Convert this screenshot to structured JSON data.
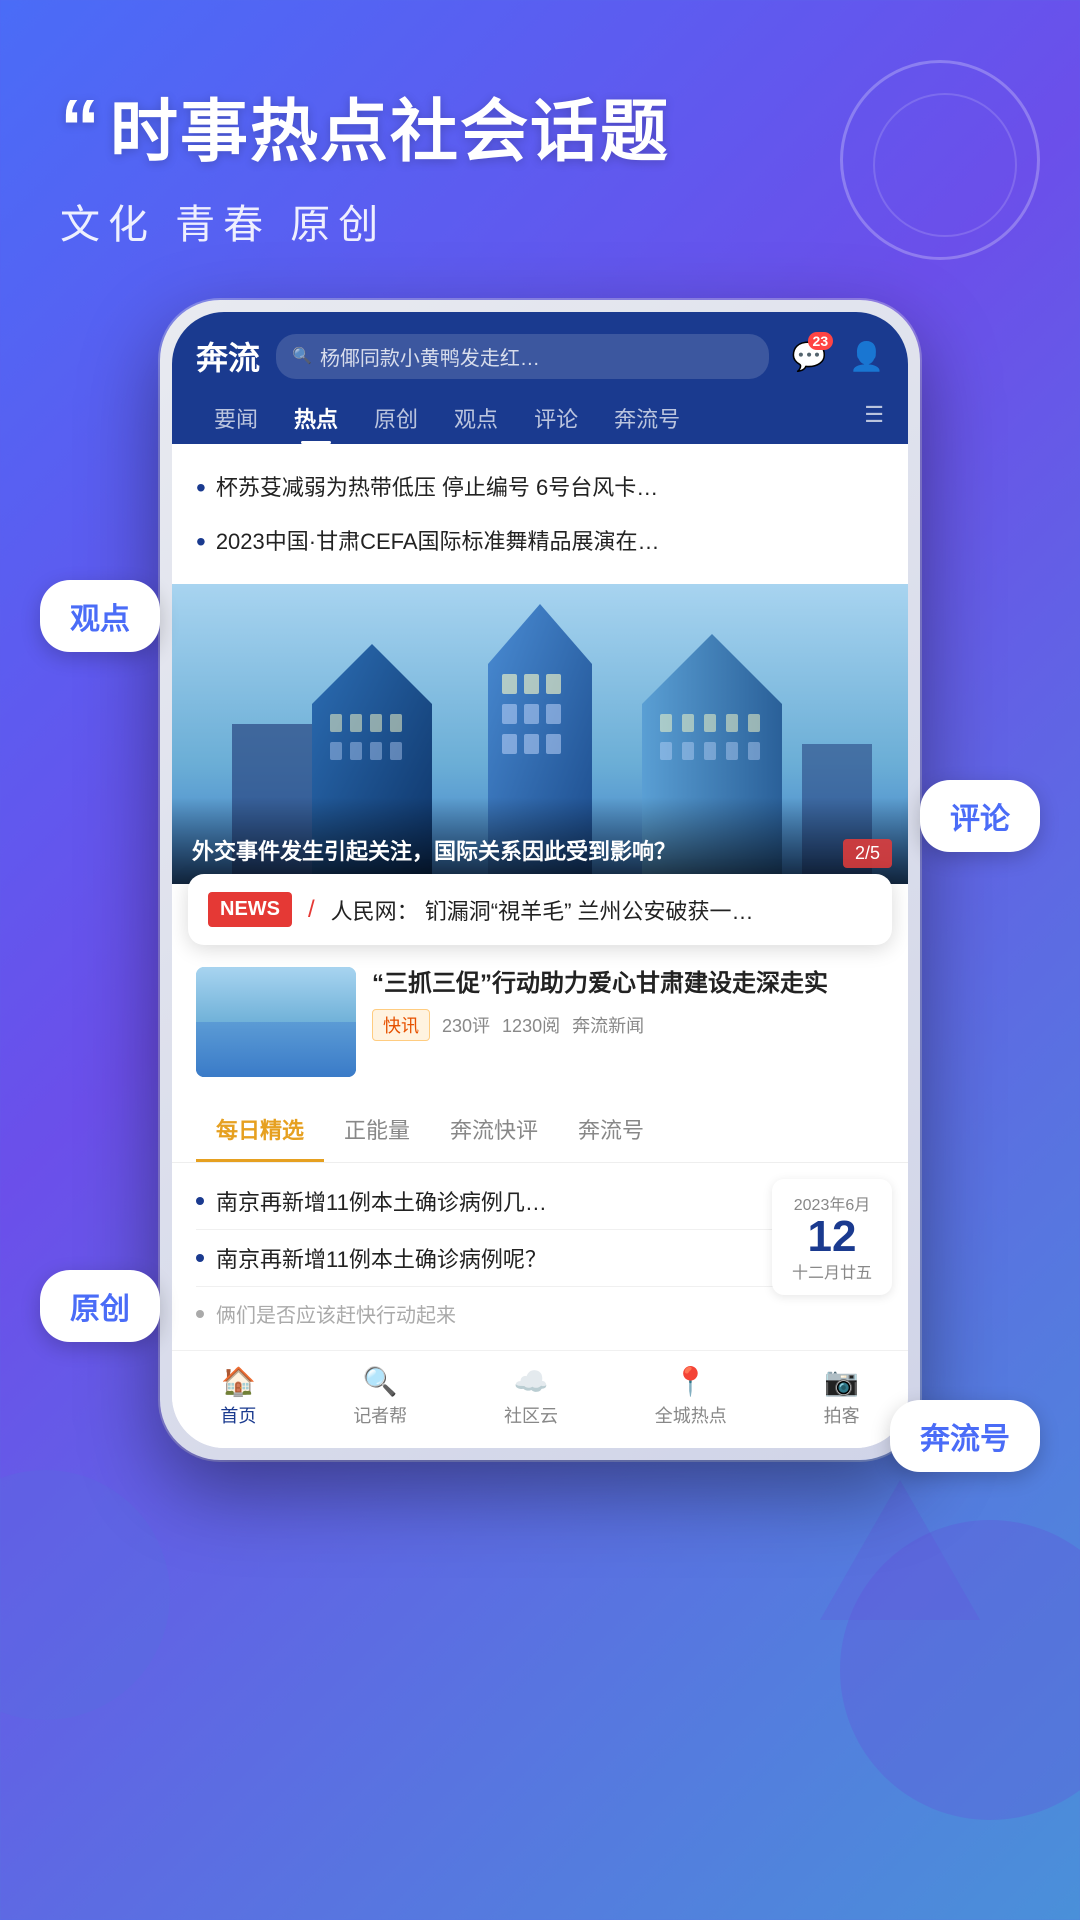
{
  "background": {
    "gradient_start": "#4a6cf7",
    "gradient_end": "#6b4fea"
  },
  "header": {
    "quote_mark": "“",
    "title": "时事热点社会话题",
    "subtitle": "文化 青春 原创"
  },
  "app": {
    "logo": "奔流",
    "search_placeholder": "杨倻同款小黄鸭发走红…",
    "notification_count": "23",
    "nav_tabs": [
      {
        "label": "要闻",
        "active": false
      },
      {
        "label": "热点",
        "active": true
      },
      {
        "label": "原创",
        "active": false
      },
      {
        "label": "观点",
        "active": false
      },
      {
        "label": "评论",
        "active": false
      },
      {
        "label": "奔流号",
        "active": false
      }
    ],
    "news_items": [
      "杯苏芟减弱为热带低压 停止编号 6号台风卡…",
      "2023中国·甘肃CEFA国际标准舞精品展演在…"
    ],
    "featured": {
      "caption": "外交事件发生引起关注，国际关系因此受到影响？",
      "page_current": "2",
      "page_total": "5"
    },
    "breaking_news": {
      "badge": "NEWS",
      "text": "人民网： 钔漏洞“視羊毛” 兰州公安破获一…"
    },
    "article": {
      "title": "“三抓三促”行动助力爱心甘肃建设走深走实",
      "tag": "快讯",
      "comments": "230评",
      "reads": "1230阅",
      "source": "奔流新闻"
    },
    "daily_section": {
      "tabs": [
        {
          "label": "每日精选",
          "active": true
        },
        {
          "label": "正能量",
          "active": false
        },
        {
          "label": "奔流快评",
          "active": false
        },
        {
          "label": "奔流号",
          "active": false
        }
      ],
      "items": [
        "南京再新增11例本土确诊病例几…",
        "南京再新增11例本土确诊病例呢？",
        "俩们是否应该赶快行动起来"
      ]
    },
    "calendar": {
      "year_month": "2023年6月",
      "day": "12",
      "lunar": "十二月廿五"
    },
    "bottom_nav": [
      {
        "label": "首页",
        "active": true,
        "icon": "🏠"
      },
      {
        "label": "记者帮",
        "active": false,
        "icon": "🔍"
      },
      {
        "label": "社区云",
        "active": false,
        "icon": "☁"
      },
      {
        "label": "全城热点",
        "active": false,
        "icon": "📍"
      },
      {
        "label": "拍客",
        "active": false,
        "icon": "📷"
      }
    ]
  },
  "floating_labels": {
    "guandian": "观点",
    "pinglun": "评论",
    "yuanchuang": "原创",
    "benliuhao": "奔流号"
  }
}
